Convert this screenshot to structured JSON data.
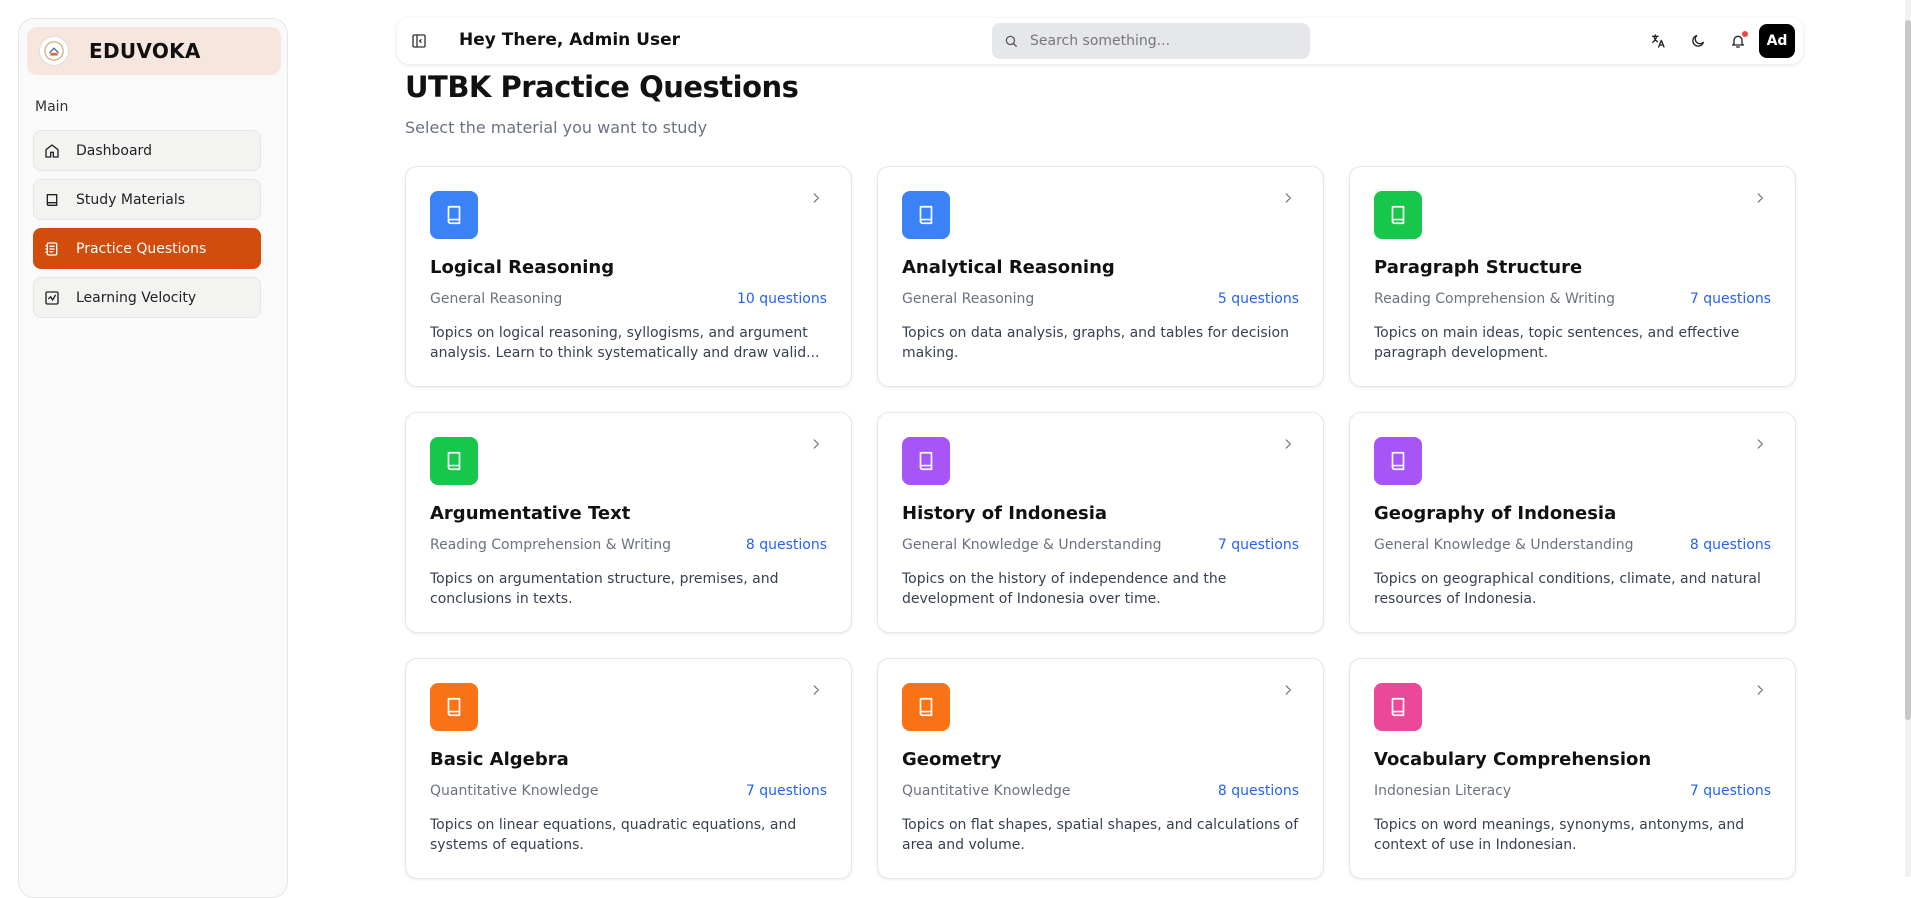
{
  "sidebar": {
    "brand": "EDUVOKA",
    "section": "Main",
    "items": [
      {
        "label": "Dashboard"
      },
      {
        "label": "Study Materials"
      },
      {
        "label": "Practice Questions"
      },
      {
        "label": "Learning Velocity"
      }
    ]
  },
  "header": {
    "greeting": "Hey There, Admin User",
    "search_placeholder": "Search something...",
    "avatar": "Ad"
  },
  "main": {
    "title": "UTBK Practice Questions",
    "subtitle": "Select the material you want to study",
    "cards": [
      {
        "title": "Logical Reasoning",
        "category": "General Reasoning",
        "count": "10 questions",
        "description": "Topics on logical reasoning, syllogisms, and argument analysis. Learn to think systematically and draw valid...",
        "color": "#3b82f6"
      },
      {
        "title": "Analytical Reasoning",
        "category": "General Reasoning",
        "count": "5 questions",
        "description": "Topics on data analysis, graphs, and tables for decision making.",
        "color": "#3b82f6"
      },
      {
        "title": "Paragraph Structure",
        "category": "Reading Comprehension & Writing",
        "count": "7 questions",
        "description": "Topics on main ideas, topic sentences, and effective paragraph development.",
        "color": "#16c74b"
      },
      {
        "title": "Argumentative Text",
        "category": "Reading Comprehension & Writing",
        "count": "8 questions",
        "description": "Topics on argumentation structure, premises, and conclusions in texts.",
        "color": "#16c74b"
      },
      {
        "title": "History of Indonesia",
        "category": "General Knowledge & Understanding",
        "count": "7 questions",
        "description": "Topics on the history of independence and the development of Indonesia over time.",
        "color": "#a855f7"
      },
      {
        "title": "Geography of Indonesia",
        "category": "General Knowledge & Understanding",
        "count": "8 questions",
        "description": "Topics on geographical conditions, climate, and natural resources of Indonesia.",
        "color": "#a855f7"
      },
      {
        "title": "Basic Algebra",
        "category": "Quantitative Knowledge",
        "count": "7 questions",
        "description": "Topics on linear equations, quadratic equations, and systems of equations.",
        "color": "#f97316"
      },
      {
        "title": "Geometry",
        "category": "Quantitative Knowledge",
        "count": "8 questions",
        "description": "Topics on flat shapes, spatial shapes, and calculations of area and volume.",
        "color": "#f97316"
      },
      {
        "title": "Vocabulary Comprehension",
        "category": "Indonesian Literacy",
        "count": "7 questions",
        "description": "Topics on word meanings, synonyms, antonyms, and context of use in Indonesian.",
        "color": "#ec4899"
      }
    ]
  },
  "colors": {
    "accent": "#d24d0c",
    "brand_bg": "#f6e6de",
    "link": "#2563eb"
  }
}
